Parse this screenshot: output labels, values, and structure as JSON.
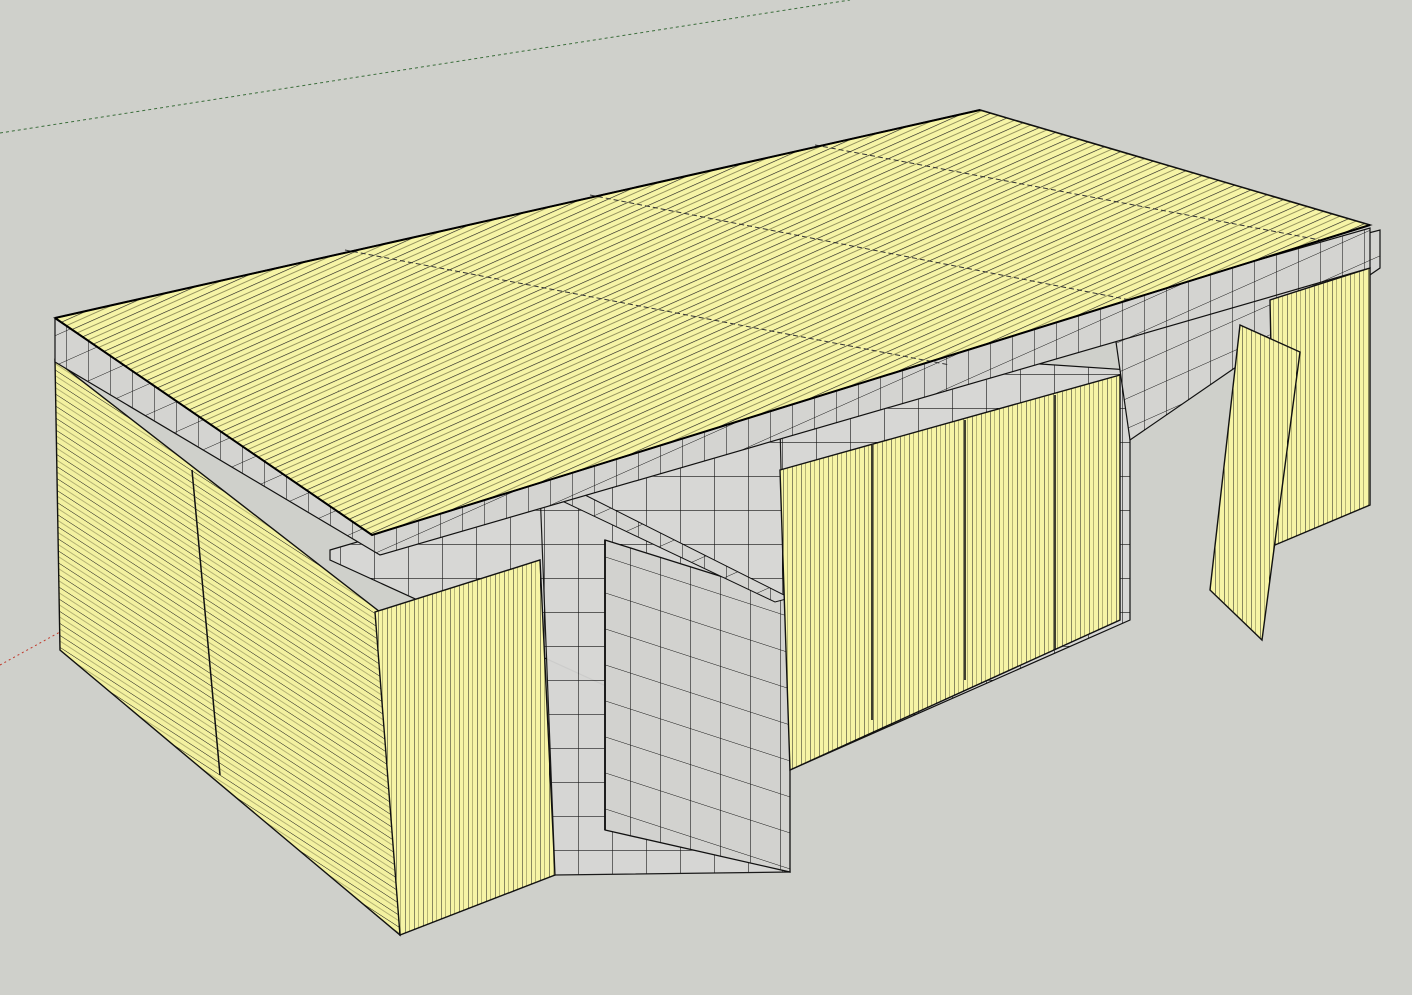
{
  "viewport": {
    "background": "#cfd0cb",
    "model": "corrugated-sheet-frame-building"
  },
  "colors": {
    "panel_fill": "#f6f4a6",
    "panel_shadow": "#d7d68a",
    "rib_line": "#1a1a1a",
    "frame_line": "#111111",
    "green_axis": "#3c8a3c",
    "red_axis": "#c0392b"
  },
  "view": {
    "style": "perspective",
    "axes_visible": true,
    "edges": "black"
  }
}
